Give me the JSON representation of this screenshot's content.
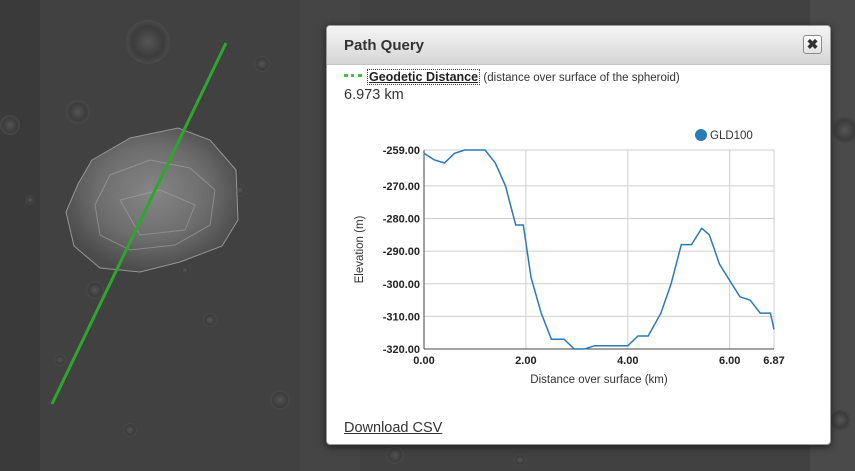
{
  "popup": {
    "title": "Path Query",
    "close_label": "✖",
    "measure_link": "Geodetic Distance",
    "measure_note": "(distance over surface of the spheroid)",
    "distance": "6.973 km",
    "download_label": "Download CSV"
  },
  "colors": {
    "path_line": "#2fa52f",
    "series": "#2a7ab8",
    "legend_dash": "#3cc33c"
  },
  "icons": {
    "close": "close-icon",
    "legend_dash": "dotted-line-swatch-icon"
  },
  "chart_data": {
    "type": "line",
    "xlabel": "Distance over surface (km)",
    "ylabel": "Elevation (m)",
    "xlim": [
      0,
      6.87
    ],
    "ylim": [
      -320,
      -259
    ],
    "x_ticks": [
      "0.00",
      "2.00",
      "4.00",
      "6.00",
      "6.87"
    ],
    "x_tick_values": [
      0,
      2,
      4,
      6,
      6.87
    ],
    "y_ticks": [
      "-259.00",
      "-270.00",
      "-280.00",
      "-290.00",
      "-300.00",
      "-310.00",
      "-320.00"
    ],
    "y_tick_values": [
      -259,
      -270,
      -280,
      -290,
      -300,
      -310,
      -320
    ],
    "grid": true,
    "legend_position": "top-right",
    "series": [
      {
        "name": "GLD100",
        "x": [
          0,
          0.2,
          0.4,
          0.6,
          0.8,
          1.0,
          1.2,
          1.4,
          1.6,
          1.8,
          1.95,
          2.1,
          2.3,
          2.5,
          2.75,
          2.95,
          3.15,
          3.35,
          3.55,
          3.75,
          4.0,
          4.2,
          4.4,
          4.65,
          4.85,
          5.05,
          5.25,
          5.45,
          5.6,
          5.8,
          6.0,
          6.2,
          6.4,
          6.6,
          6.8,
          6.87
        ],
        "y": [
          -260,
          -262,
          -263,
          -260,
          -259,
          -259,
          -259,
          -263,
          -270,
          -282,
          -282,
          -298,
          -309,
          -317,
          -317,
          -320,
          -320,
          -319,
          -319,
          -319,
          -319,
          -316,
          -316,
          -309,
          -300,
          -288,
          -288,
          -283,
          -285,
          -294,
          -299,
          -304,
          -305,
          -309,
          -309,
          -314
        ]
      }
    ]
  }
}
